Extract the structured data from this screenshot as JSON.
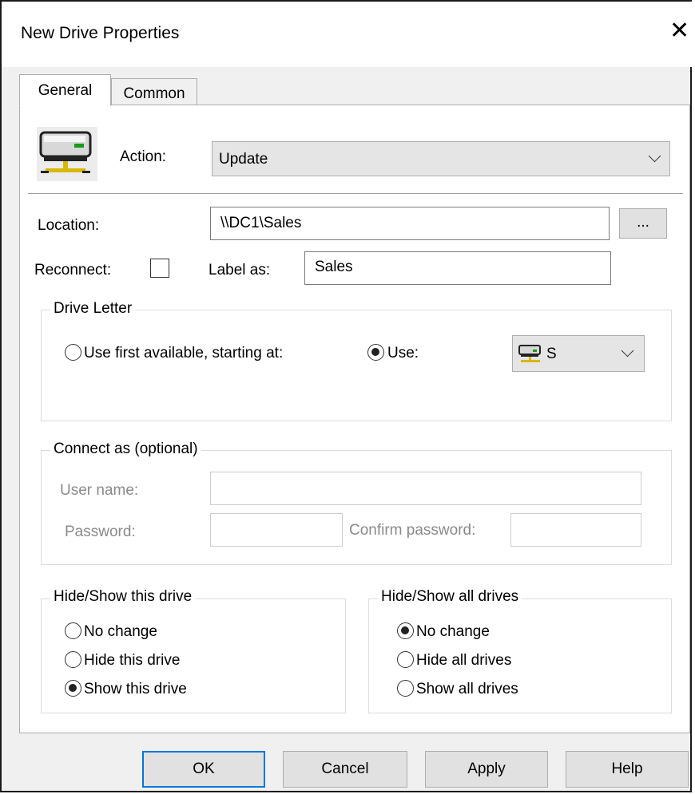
{
  "window": {
    "title": "New Drive Properties"
  },
  "tabs": [
    {
      "label": "General",
      "active": true
    },
    {
      "label": "Common",
      "active": false
    }
  ],
  "general": {
    "action_label": "Action:",
    "action_value": "Update",
    "location_label": "Location:",
    "location_value": "\\\\DC1\\Sales",
    "browse_label": "...",
    "reconnect_label": "Reconnect:",
    "reconnect_checked": false,
    "label_as_label": "Label as:",
    "label_as_value": "Sales"
  },
  "drive_letter": {
    "group_label": "Drive Letter",
    "first_available_label": "Use first available, starting at:",
    "use_label": "Use:",
    "selected_option": "use",
    "letter_value": "S"
  },
  "connect_as": {
    "group_label": "Connect as (optional)",
    "user_name_label": "User name:",
    "user_name_value": "",
    "password_label": "Password:",
    "password_value": "",
    "confirm_password_label": "Confirm password:",
    "confirm_password_value": ""
  },
  "hide_show_this": {
    "group_label": "Hide/Show this drive",
    "options": [
      "No change",
      "Hide this drive",
      "Show this drive"
    ],
    "selected": "Show this drive"
  },
  "hide_show_all": {
    "group_label": "Hide/Show all drives",
    "options": [
      "No change",
      "Hide all drives",
      "Show all drives"
    ],
    "selected": "No change"
  },
  "buttons": {
    "ok": "OK",
    "cancel": "Cancel",
    "apply": "Apply",
    "help": "Help"
  },
  "icons": {
    "drive": "network-drive-icon",
    "close": "close-icon",
    "dropdown": "chevron-down-icon"
  },
  "colors": {
    "default_button_border": "#0078d7",
    "window_bg": "#f0f0f0"
  }
}
